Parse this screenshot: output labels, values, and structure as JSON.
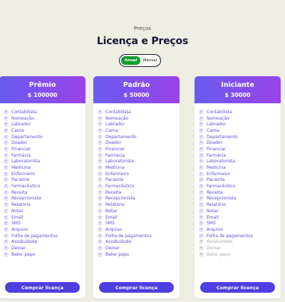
{
  "header": {
    "eyebrow": "Preços",
    "title": "Licença e Preços"
  },
  "billing_toggle": {
    "options": [
      "Anual",
      "Mensal"
    ],
    "selected": "Anual"
  },
  "plans": [
    {
      "name": "Prêmio",
      "price": "$ 100000",
      "button_label": "Comprar licença",
      "features": [
        {
          "label": "Contabilista",
          "included": true
        },
        {
          "label": "Nomeação",
          "included": true
        },
        {
          "label": "Labrador",
          "included": true
        },
        {
          "label": "Cama",
          "included": true
        },
        {
          "label": "Departamento",
          "included": true
        },
        {
          "label": "Doador",
          "included": true
        },
        {
          "label": "Financiar",
          "included": true
        },
        {
          "label": "Farmácia",
          "included": true
        },
        {
          "label": "Laboratorista",
          "included": true
        },
        {
          "label": "Medicina",
          "included": true
        },
        {
          "label": "Enfermeiro",
          "included": true
        },
        {
          "label": "Paciente",
          "included": true
        },
        {
          "label": "Farmacêutico",
          "included": true
        },
        {
          "label": "Receita",
          "included": true
        },
        {
          "label": "Recepcionista",
          "included": true
        },
        {
          "label": "Relatório",
          "included": true
        },
        {
          "label": "Notar",
          "included": true
        },
        {
          "label": "Email",
          "included": true
        },
        {
          "label": "SMS",
          "included": true
        },
        {
          "label": "Arquivo",
          "included": true
        },
        {
          "label": "Folha de pagamentos",
          "included": true
        },
        {
          "label": "Assiduidade",
          "included": true
        },
        {
          "label": "Deixar",
          "included": true
        },
        {
          "label": "Bater papo",
          "included": true
        }
      ]
    },
    {
      "name": "Padrão",
      "price": "$ 50000",
      "button_label": "Comprar licença",
      "features": [
        {
          "label": "Contabilista",
          "included": true
        },
        {
          "label": "Nomeação",
          "included": true
        },
        {
          "label": "Labrador",
          "included": true
        },
        {
          "label": "Cama",
          "included": true
        },
        {
          "label": "Departamento",
          "included": true
        },
        {
          "label": "Doador",
          "included": true
        },
        {
          "label": "Financiar",
          "included": true
        },
        {
          "label": "Farmácia",
          "included": true
        },
        {
          "label": "Laboratorista",
          "included": true
        },
        {
          "label": "Medicina",
          "included": true
        },
        {
          "label": "Enfermeiro",
          "included": true
        },
        {
          "label": "Paciente",
          "included": true
        },
        {
          "label": "Farmacêutico",
          "included": true
        },
        {
          "label": "Receita",
          "included": true
        },
        {
          "label": "Recepcionista",
          "included": true
        },
        {
          "label": "Relatório",
          "included": true
        },
        {
          "label": "Notar",
          "included": true
        },
        {
          "label": "Email",
          "included": true
        },
        {
          "label": "SMS",
          "included": true
        },
        {
          "label": "Arquivo",
          "included": true
        },
        {
          "label": "Folha de pagamentos",
          "included": true
        },
        {
          "label": "Assiduidade",
          "included": true
        },
        {
          "label": "Deixar",
          "included": true
        },
        {
          "label": "Bater papo",
          "included": true
        }
      ]
    },
    {
      "name": "Iniciante",
      "price": "$ 30000",
      "button_label": "Comprar licença",
      "features": [
        {
          "label": "Contabilista",
          "included": true
        },
        {
          "label": "Nomeação",
          "included": true
        },
        {
          "label": "Labrador",
          "included": true
        },
        {
          "label": "Cama",
          "included": true
        },
        {
          "label": "Departamento",
          "included": true
        },
        {
          "label": "Doador",
          "included": true
        },
        {
          "label": "Financiar",
          "included": true
        },
        {
          "label": "Farmácia",
          "included": true
        },
        {
          "label": "Laboratorista",
          "included": true
        },
        {
          "label": "Medicina",
          "included": true
        },
        {
          "label": "Enfermeiro",
          "included": true
        },
        {
          "label": "Paciente",
          "included": true
        },
        {
          "label": "Farmacêutico",
          "included": true
        },
        {
          "label": "Receita",
          "included": true
        },
        {
          "label": "Recepcionista",
          "included": true
        },
        {
          "label": "Relatório",
          "included": true
        },
        {
          "label": "Notar",
          "included": true
        },
        {
          "label": "Email",
          "included": true
        },
        {
          "label": "SMS",
          "included": true
        },
        {
          "label": "Arquivo",
          "included": true
        },
        {
          "label": "Folha de pagamentos",
          "included": true
        },
        {
          "label": "Assiduidade",
          "included": false
        },
        {
          "label": "Deixar",
          "included": false
        },
        {
          "label": "Bater papo",
          "included": false
        }
      ]
    }
  ],
  "icons": {
    "included": "check-icon",
    "excluded": "cross-icon"
  },
  "colors": {
    "background": "#eeeee3",
    "accent": "#6a5bf0",
    "gradient_end": "#9a43e8",
    "toggle_active": "#0c9c2a",
    "button": "#4e3fe0"
  }
}
